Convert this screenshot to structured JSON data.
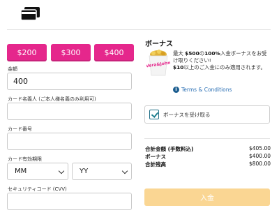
{
  "header": {
    "icon": "credit-card-icon"
  },
  "amounts": [
    "$200",
    "$300",
    "$400"
  ],
  "form": {
    "amount_label": "金額",
    "amount_value": "400",
    "name_label": "カード名義人 (ご本人様名義のみ利用可)",
    "name_value": "",
    "number_label": "カード番号",
    "number_value": "",
    "expiry_label": "カード有効期限",
    "month_value": "MM",
    "year_value": "YY",
    "cvv_label": "セキュリティコード (CVV)",
    "cvv_value": ""
  },
  "bonus": {
    "title": "ボーナス",
    "line1_a": "最大 ",
    "line1_b": "$500",
    "line1_c": "の",
    "line1_d": "100%",
    "line1_e": "入金ボーナスをお受け取りください!",
    "line2_a": "$10",
    "line2_b": "以上のご入金にのみ適用されます。",
    "terms": "Terms & Conditions",
    "claim_label": "ボーナスを受け取る",
    "claim_checked": true,
    "image_text": "Vera&John"
  },
  "summary": [
    {
      "key": "合計金額 (手数料込)",
      "value": "$405.00"
    },
    {
      "key": "ボーナス",
      "value": "$400.00"
    },
    {
      "key": "合計残高",
      "value": "$800.00"
    }
  ],
  "deposit_button": "入金",
  "colors": {
    "accent_pink": "#e5278c",
    "deposit_disabled": "#fad693",
    "link_blue": "#2a6fb4",
    "check_teal": "#1f7f8f"
  }
}
